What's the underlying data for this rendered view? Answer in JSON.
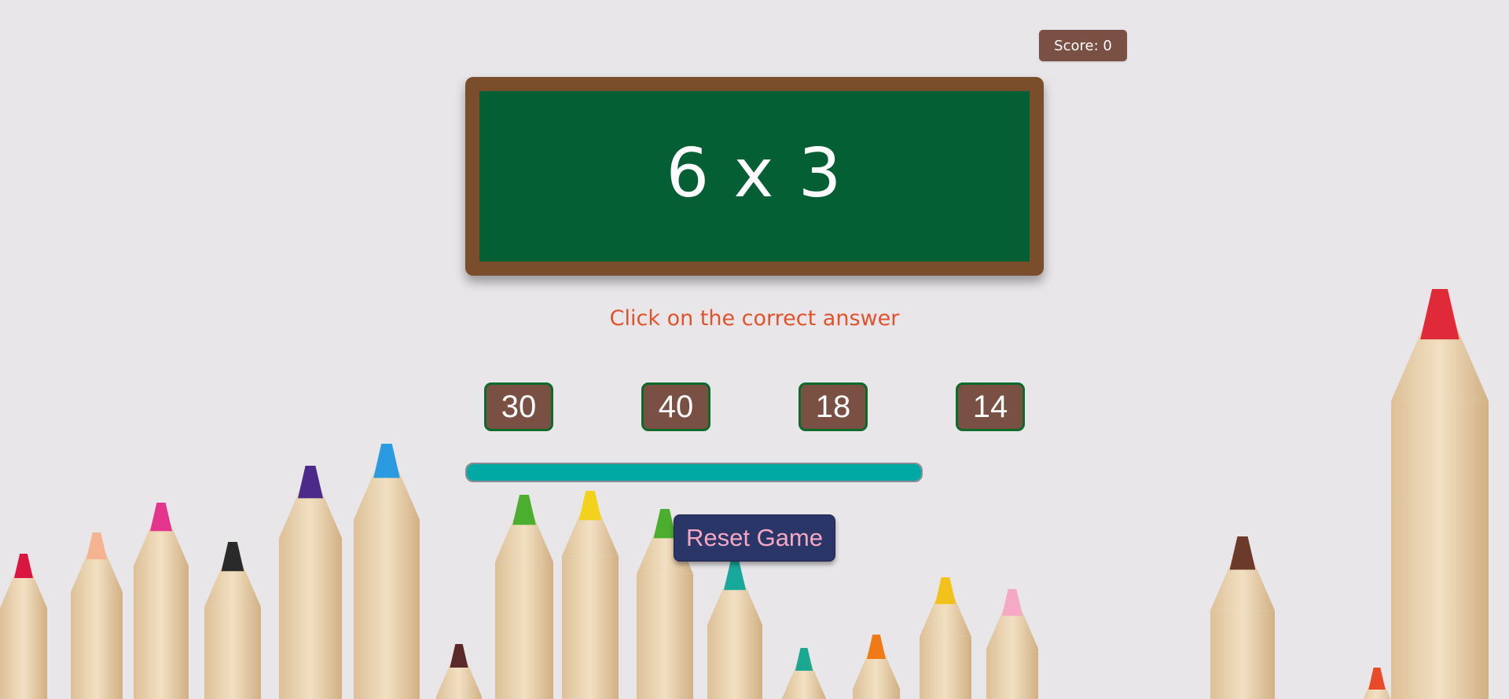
{
  "score": {
    "label": "Score: 0"
  },
  "question": {
    "text": "6 x 3"
  },
  "instruction": "Click on the correct answer",
  "answers": [
    "30",
    "40",
    "18",
    "14"
  ],
  "timer": {
    "remaining_fraction": 1.0
  },
  "reset_button": {
    "label": "Reset Game"
  },
  "colors": {
    "board": "#055f35",
    "frame": "#7b4e2b",
    "answer_bg": "#7b5044",
    "answer_border": "#0c6a2b",
    "timer_fill": "#00a9a3",
    "reset_bg": "#2a3568",
    "reset_text": "#f3a9c4",
    "instruction_text": "#e0532a"
  },
  "background": {
    "icon": "colored-pencils-image"
  }
}
